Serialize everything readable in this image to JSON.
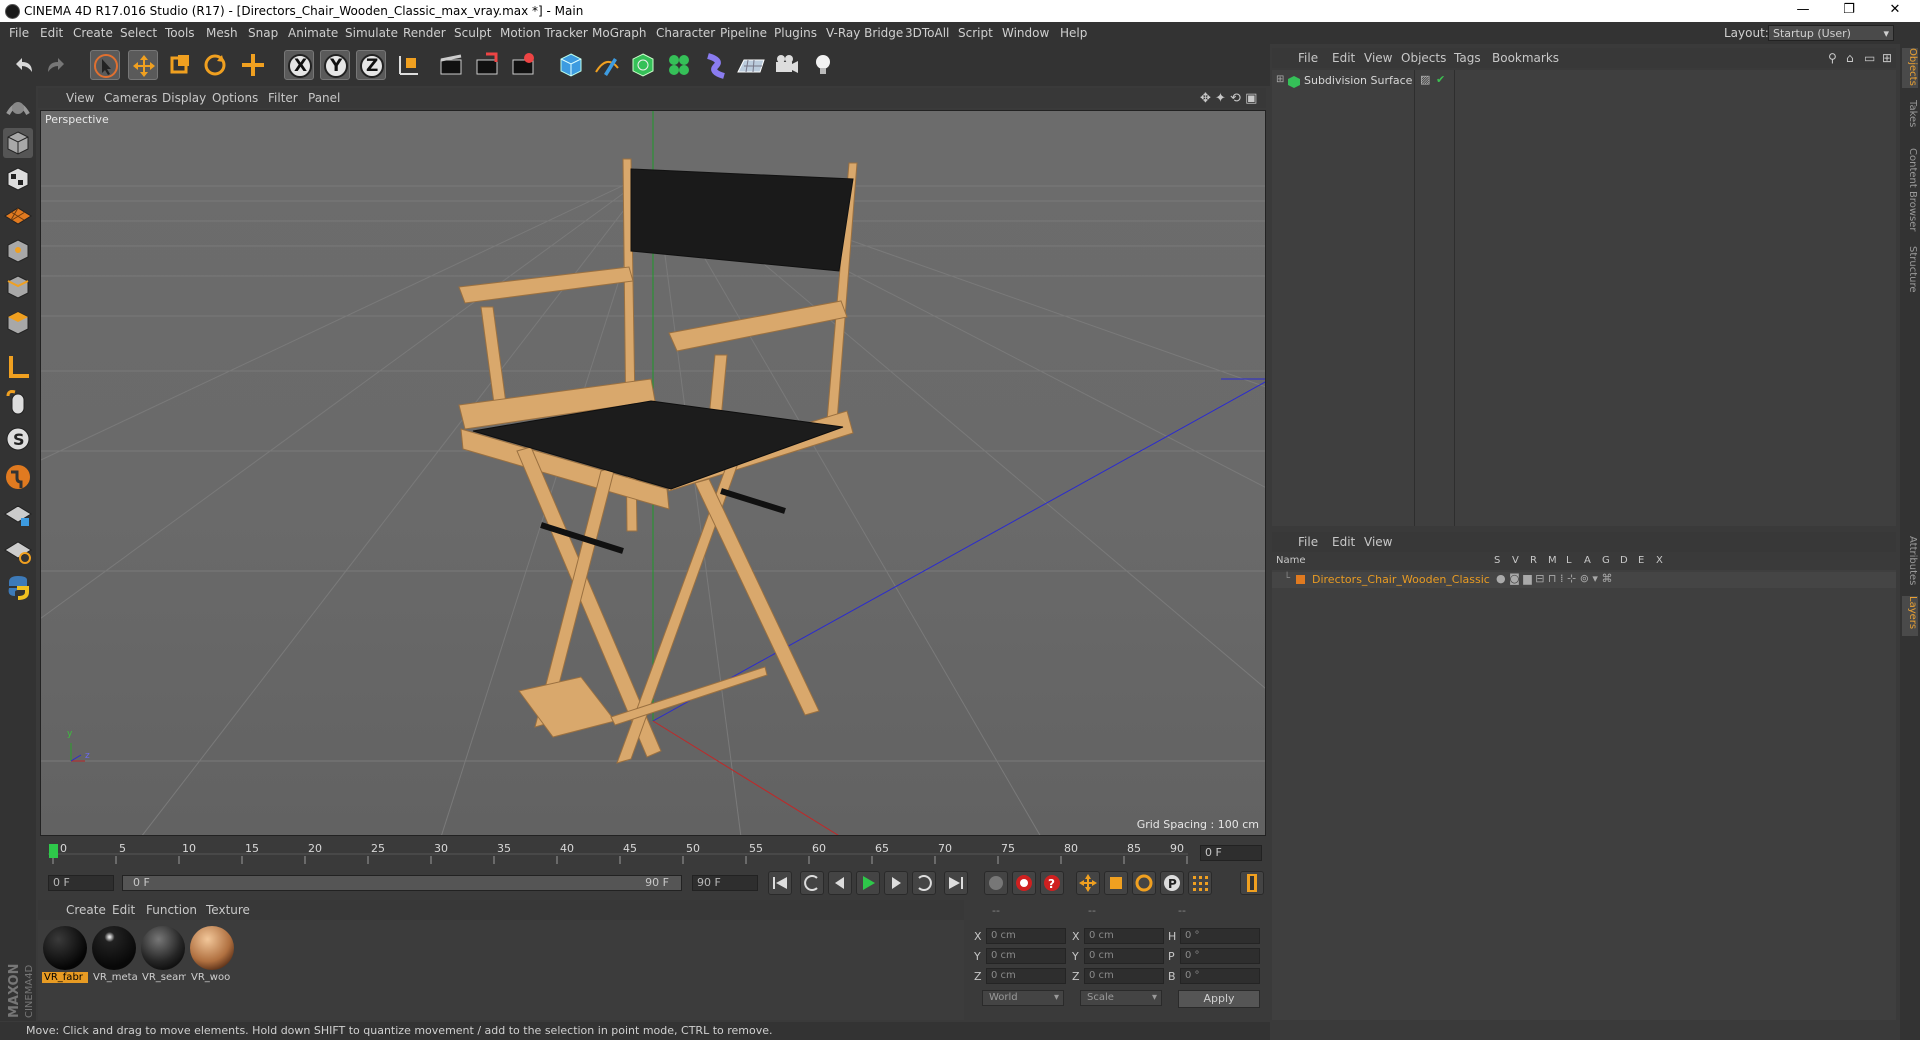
{
  "window": {
    "title": "CINEMA 4D R17.016 Studio (R17) - [Directors_Chair_Wooden_Classic_max_vray.max *] - Main",
    "controls": {
      "minimize": "—",
      "restore": "❐",
      "close": "✕"
    }
  },
  "menubar": {
    "items": [
      "File",
      "Edit",
      "Create",
      "Select",
      "Tools",
      "Mesh",
      "Snap",
      "Animate",
      "Simulate",
      "Render",
      "Sculpt",
      "Motion Tracker",
      "MoGraph",
      "Character",
      "Pipeline",
      "Plugins",
      "V-Ray Bridge",
      "3DToAll",
      "Script",
      "Window",
      "Help"
    ],
    "layout_label": "Layout:",
    "layout_value": "Startup (User)"
  },
  "toolbar": {
    "axis_x": "X",
    "axis_y": "Y",
    "axis_z": "Z"
  },
  "viewport": {
    "menu": [
      "View",
      "Cameras",
      "Display",
      "Options",
      "Filter",
      "Panel"
    ],
    "label": "Perspective",
    "grid_spacing": "Grid Spacing : 100 cm",
    "axis_y": "y",
    "axis_z": "z"
  },
  "timeline": {
    "ticks": [
      "0",
      "5",
      "10",
      "15",
      "20",
      "25",
      "30",
      "35",
      "40",
      "45",
      "50",
      "55",
      "60",
      "65",
      "70",
      "75",
      "80",
      "85",
      "90"
    ],
    "current_frame": "0 F"
  },
  "transport": {
    "start_field": "0 F",
    "range_start": "0 F",
    "range_end": "90 F",
    "end_field": "90 F"
  },
  "materials": {
    "menu": [
      "Create",
      "Edit",
      "Function",
      "Texture"
    ],
    "items": [
      {
        "label": "VR_fabr",
        "selected": true
      },
      {
        "label": "VR_meta",
        "selected": false
      },
      {
        "label": "VR_seam",
        "selected": false
      },
      {
        "label": "VR_woo",
        "selected": false
      }
    ]
  },
  "coordinates": {
    "headers": [
      "--",
      "--",
      "--"
    ],
    "rows": [
      {
        "a": "X",
        "a_val": "0 cm",
        "b": "X",
        "b_val": "0 cm",
        "c": "H",
        "c_val": "0 °"
      },
      {
        "a": "Y",
        "a_val": "0 cm",
        "b": "Y",
        "b_val": "0 cm",
        "c": "P",
        "c_val": "0 °"
      },
      {
        "a": "Z",
        "a_val": "0 cm",
        "b": "Z",
        "b_val": "0 cm",
        "c": "B",
        "c_val": "0 °"
      }
    ],
    "world": "World",
    "scale": "Scale",
    "apply": "Apply"
  },
  "statusbar": {
    "text": "Move: Click and drag to move elements. Hold down SHIFT to quantize movement / add to the selection in point mode, CTRL to remove."
  },
  "objects_panel": {
    "menu": [
      "File",
      "Edit",
      "View",
      "Objects",
      "Tags",
      "Bookmarks"
    ],
    "object": "Subdivision Surface"
  },
  "layers_panel": {
    "menu": [
      "File",
      "Edit",
      "View"
    ],
    "columns": [
      "Name",
      "S",
      "V",
      "R",
      "M",
      "L",
      "A",
      "G",
      "D",
      "E",
      "X"
    ],
    "layer": "Directors_Chair_Wooden_Classic"
  },
  "side_tabs": [
    "Objects",
    "Takes",
    "Content Browser",
    "Structure",
    "Attributes",
    "Layers"
  ],
  "brand": {
    "logo_text": "MAXON CINEMA 4D"
  },
  "colors": {
    "accent": "#e89b23",
    "bg": "#3a3a3a",
    "panel": "#333333"
  }
}
